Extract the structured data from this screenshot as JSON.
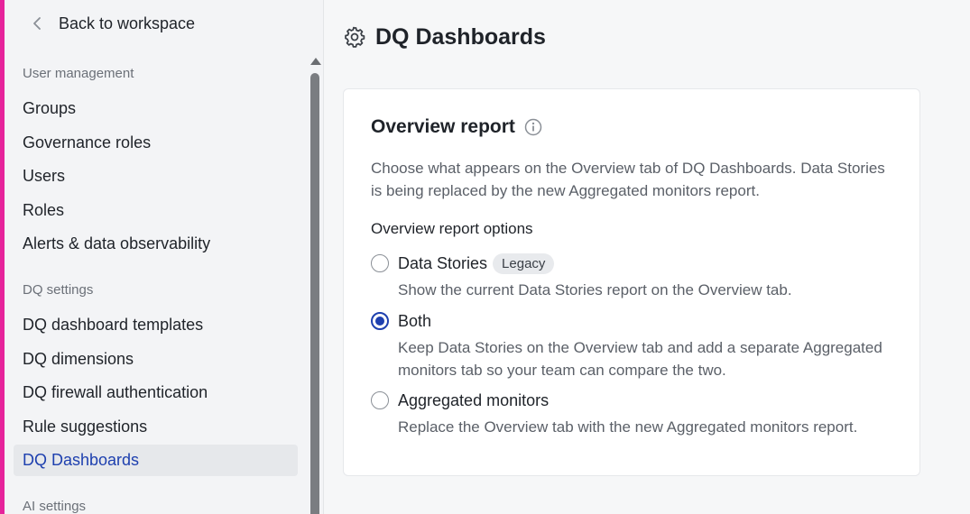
{
  "sidebar": {
    "back_label": "Back to workspace",
    "sections": [
      {
        "label": "User management",
        "items": [
          {
            "label": "Groups"
          },
          {
            "label": "Governance roles"
          },
          {
            "label": "Users"
          },
          {
            "label": "Roles"
          },
          {
            "label": "Alerts & data observability"
          }
        ]
      },
      {
        "label": "DQ settings",
        "items": [
          {
            "label": "DQ dashboard templates"
          },
          {
            "label": "DQ dimensions"
          },
          {
            "label": "DQ firewall authentication"
          },
          {
            "label": "Rule suggestions"
          },
          {
            "label": "DQ Dashboards",
            "active": true
          }
        ]
      },
      {
        "label": "AI settings",
        "items": []
      }
    ]
  },
  "header": {
    "title": "DQ Dashboards",
    "icon": "gear-icon"
  },
  "card": {
    "title": "Overview report",
    "description": "Choose what appears on the Overview tab of DQ Dashboards. Data Stories is being replaced by the new Aggregated monitors report.",
    "options_label": "Overview report options",
    "options": [
      {
        "label": "Data Stories",
        "badge": "Legacy",
        "description": "Show the current Data Stories report on the Overview tab.",
        "checked": false
      },
      {
        "label": "Both",
        "description": "Keep Data Stories on the Overview tab and add a separate Aggregated monitors tab so your team can compare the two.",
        "checked": true
      },
      {
        "label": "Aggregated monitors",
        "description": "Replace the Overview tab with the new Aggregated monitors report.",
        "checked": false
      }
    ]
  },
  "colors": {
    "accent_bar": "#e6239b",
    "selected": "#1e40af",
    "sidebar_bg": "#f3f4f6",
    "page_bg": "#f6f7f8"
  }
}
